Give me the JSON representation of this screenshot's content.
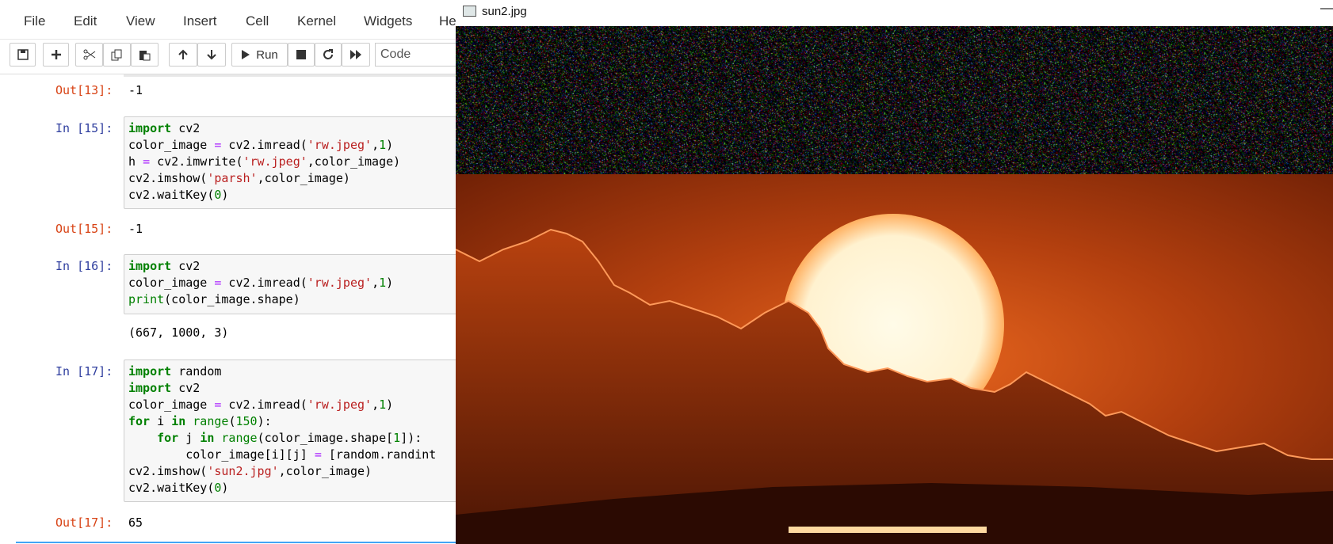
{
  "menubar": {
    "items": [
      "File",
      "Edit",
      "View",
      "Insert",
      "Cell",
      "Kernel",
      "Widgets",
      "He"
    ]
  },
  "toolbar": {
    "run_label": "Run",
    "cell_type": "Code",
    "icons": [
      "save-icon",
      "plus-icon",
      "cut-icon",
      "copy-icon",
      "paste-icon",
      "arrow-up-icon",
      "arrow-down-icon",
      "play-icon",
      "stop-icon",
      "restart-icon",
      "fast-forward-icon"
    ]
  },
  "cells": {
    "out13": {
      "prompt": "Out[13]:",
      "text": "-1"
    },
    "in15": {
      "prompt": "In [15]:"
    },
    "out15": {
      "prompt": "Out[15]:",
      "text": "-1"
    },
    "in16": {
      "prompt": "In [16]:"
    },
    "out16": {
      "text": "(667, 1000, 3)"
    },
    "in17": {
      "prompt": "In [17]:"
    },
    "out17": {
      "prompt": "Out[17]:",
      "text": "65"
    }
  },
  "code": {
    "c15_l1": "import cv2",
    "c15_l2": "color_image = cv2.imread('rw.jpeg',1)",
    "c15_l3": "h = cv2.imwrite('rw.jpeg',color_image)",
    "c15_l4": "cv2.imshow('parsh',color_image)",
    "c15_l5": "cv2.waitKey(0)",
    "c16_l1": "import cv2",
    "c16_l2": "color_image = cv2.imread('rw.jpeg',1)",
    "c16_l3": "print(color_image.shape)",
    "c17_l1": "import random",
    "c17_l2": "import cv2",
    "c17_l3": "color_image = cv2.imread('rw.jpeg',1)",
    "c17_l4": "for i in range(150):",
    "c17_l5": "    for j in range(color_image.shape[1]):",
    "c17_l6": "        color_image[i][j] = [random.randint",
    "c17_l7": "cv2.imshow('sun2.jpg',color_image)",
    "c17_l8": "cv2.waitKey(0)"
  },
  "image_window": {
    "title": "sun2.jpg",
    "minimize_glyph": "—"
  },
  "colors": {
    "prompt_in": "#303f9f",
    "prompt_out": "#d84315",
    "keyword": "#008000",
    "string": "#ba2121",
    "operator": "#aa22ff"
  }
}
